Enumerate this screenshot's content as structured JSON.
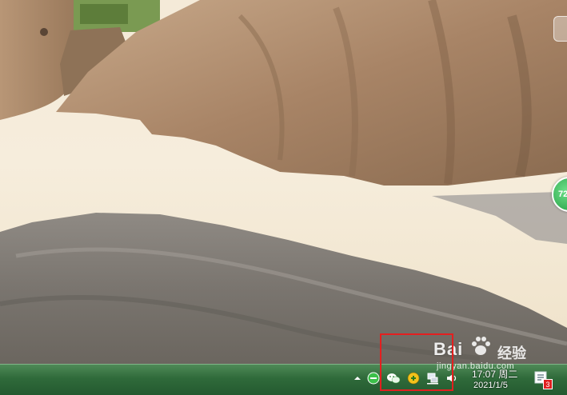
{
  "taskbar": {
    "tray": {
      "overflow_arrow_icon": "up-arrow-icon",
      "icons": [
        "green-360-icon",
        "wechat-icon",
        "yellow-shield-icon",
        "network-icon",
        "volume-icon"
      ]
    },
    "clock": {
      "time": "17:07 周二",
      "date": "2021/1/5"
    },
    "notification": {
      "count": "3"
    }
  },
  "watermark": {
    "logo": "Bai",
    "cn": "经验",
    "url": "jingyan.baidu.com"
  },
  "gadget": {
    "label": "72"
  },
  "colors": {
    "highlight": "#e41f1f",
    "taskbar_top": "#4f8a57",
    "taskbar_bottom": "#245a30"
  }
}
